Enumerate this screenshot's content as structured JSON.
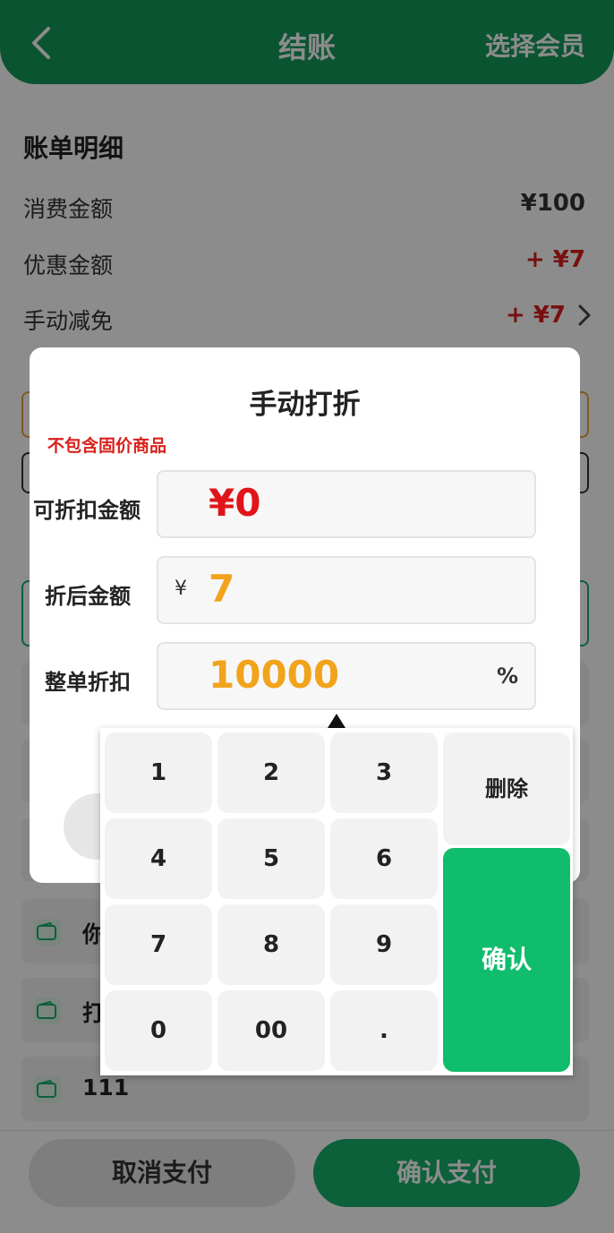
{
  "header": {
    "title": "结账",
    "member_label": "选择会员",
    "back_icon": "chevron-left-icon"
  },
  "bill": {
    "title": "账单明细",
    "rows": [
      {
        "label": "消费金额",
        "value": "¥100"
      },
      {
        "label": "优惠金额",
        "value": "+ ¥7"
      },
      {
        "label": "手动减免",
        "value": "+ ¥7"
      }
    ]
  },
  "payments": [
    {
      "label": "你"
    },
    {
      "label": "打"
    },
    {
      "label": "111"
    }
  ],
  "footer": {
    "cancel_label": "取消支付",
    "confirm_label": "确认支付"
  },
  "dialog": {
    "title": "手动打折",
    "note": "不包含固价商品",
    "discountable": {
      "label": "可折扣金额",
      "value": "¥0"
    },
    "after": {
      "label": "折后金额",
      "currency": "¥",
      "value": "7"
    },
    "discount": {
      "label": "整单折扣",
      "value": "10000",
      "unit": "%"
    }
  },
  "keypad": {
    "keys": [
      "1",
      "2",
      "3",
      "4",
      "5",
      "6",
      "7",
      "8",
      "9",
      "0",
      "00",
      "."
    ],
    "delete_label": "删除",
    "confirm_label": "确认"
  },
  "colors": {
    "primary": "#17b06a",
    "header": "#159a5c",
    "red": "#e0141a",
    "orange": "#f2a31c"
  }
}
